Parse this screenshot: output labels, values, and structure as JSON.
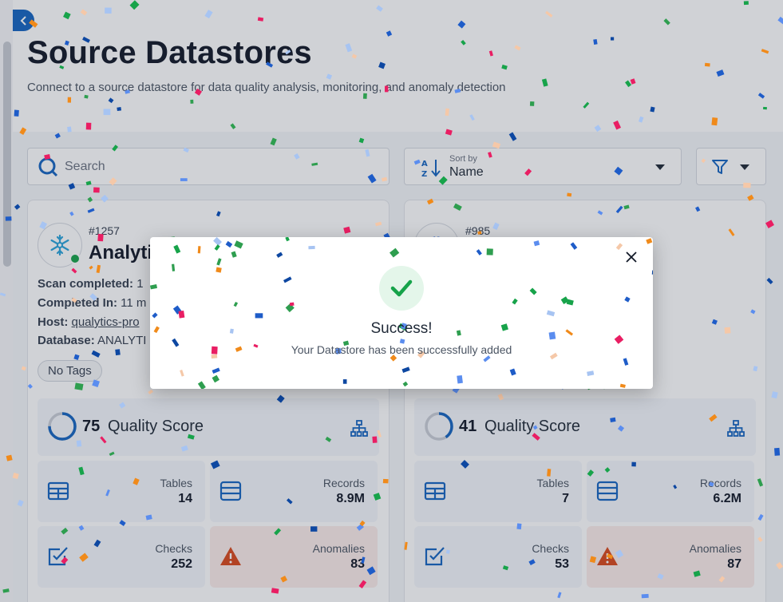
{
  "header": {
    "title": "Source Datastores",
    "subtitle": "Connect to a source datastore for data quality analysis, monitoring, and anomaly detection"
  },
  "toolbar": {
    "search_placeholder": "Search",
    "sort_label": "Sort by",
    "sort_value": "Name"
  },
  "cards": [
    {
      "id": "#1257",
      "name": "Analyti",
      "scan_label": "Scan completed:",
      "scan_value": "1",
      "completed_label": "Completed In:",
      "completed_value": "11 m",
      "host_label": "Host:",
      "host_value": "qualytics-pro",
      "database_label": "Database:",
      "database_value": "ANALYTI",
      "tag": "No Tags",
      "quality_score": "75",
      "quality_label": "Quality Score",
      "quality_fraction": 0.75,
      "stats": [
        {
          "label": "Tables",
          "value": "14"
        },
        {
          "label": "Records",
          "value": "8.9M"
        },
        {
          "label": "Checks",
          "value": "252"
        },
        {
          "label": "Anomalies",
          "value": "83"
        }
      ]
    },
    {
      "id": "#985",
      "quality_score": "41",
      "quality_label": "Quality Score",
      "quality_fraction": 0.41,
      "stats": [
        {
          "label": "Tables",
          "value": "7"
        },
        {
          "label": "Records",
          "value": "6.2M"
        },
        {
          "label": "Checks",
          "value": "53"
        },
        {
          "label": "Anomalies",
          "value": "87"
        }
      ]
    }
  ],
  "modal": {
    "title": "Success!",
    "message": "Your Datastore has been successfully added"
  },
  "colors": {
    "accent": "#1565c0",
    "success": "#16a34a",
    "warning": "#d9481c",
    "confetti": [
      "#1e5cc8",
      "#5b8def",
      "#2e9e4f",
      "#f08a1a",
      "#e91e63",
      "#a7c4f2",
      "#f5c8a8",
      "#17a34a",
      "#0d47a1"
    ]
  }
}
